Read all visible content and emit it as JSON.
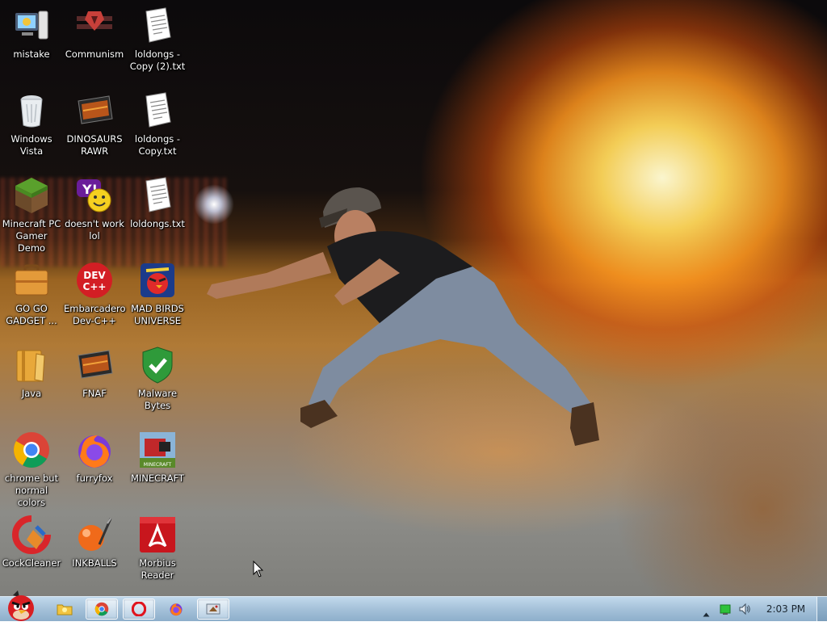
{
  "desktop": {
    "icons": [
      {
        "label": "mistake",
        "icon": "computer-icon"
      },
      {
        "label": "Communism",
        "icon": "papers-please-icon"
      },
      {
        "label": "loldongs - Copy (2).txt",
        "icon": "text-file-icon"
      },
      {
        "label": "Windows Vista",
        "icon": "recycle-bin-icon"
      },
      {
        "label": "DINOSAURS RAWR",
        "icon": "game-shortcut-icon"
      },
      {
        "label": "loldongs - Copy.txt",
        "icon": "text-file-icon"
      },
      {
        "label": "Minecraft PC Gamer Demo",
        "icon": "grass-block-icon"
      },
      {
        "label": "doesn't work lol",
        "icon": "yahoo-messenger-icon"
      },
      {
        "label": "loldongs.txt",
        "icon": "text-file-icon"
      },
      {
        "label": "GO GO GADGET ...",
        "icon": "briefcase-icon"
      },
      {
        "label": "Embarcadero Dev-C++",
        "icon": "dev-cpp-icon"
      },
      {
        "label": "MAD BIRDS UNIVERSE",
        "icon": "angry-birds-space-icon"
      },
      {
        "label": "Java",
        "icon": "java-icon"
      },
      {
        "label": "FNAF",
        "icon": "game-shortcut-icon"
      },
      {
        "label": "Malware Bytes",
        "icon": "shield-check-icon"
      },
      {
        "label": "chrome but normal colors",
        "icon": "chrome-icon"
      },
      {
        "label": "furryfox",
        "icon": "firefox-icon"
      },
      {
        "label": "MINECRAFT",
        "icon": "minecraft-birds-icon"
      },
      {
        "label": "CockCleaner",
        "icon": "ccleaner-icon"
      },
      {
        "label": "INKBALLS",
        "icon": "inkball-icon"
      },
      {
        "label": "Morbius Reader",
        "icon": "pdf-reader-icon"
      }
    ]
  },
  "taskbar": {
    "start_icon": "angry-bird-start-icon",
    "pinned": [
      {
        "name": "explorer",
        "icon": "folder-icon"
      },
      {
        "name": "chrome",
        "icon": "chrome-icon"
      },
      {
        "name": "opera",
        "icon": "opera-icon"
      },
      {
        "name": "firefox",
        "icon": "firefox-icon"
      },
      {
        "name": "app",
        "icon": "app-window-icon"
      }
    ],
    "tray": {
      "clock": "2:03 PM",
      "icons": [
        "show-hidden-icon",
        "network-icon",
        "volume-icon"
      ]
    }
  }
}
